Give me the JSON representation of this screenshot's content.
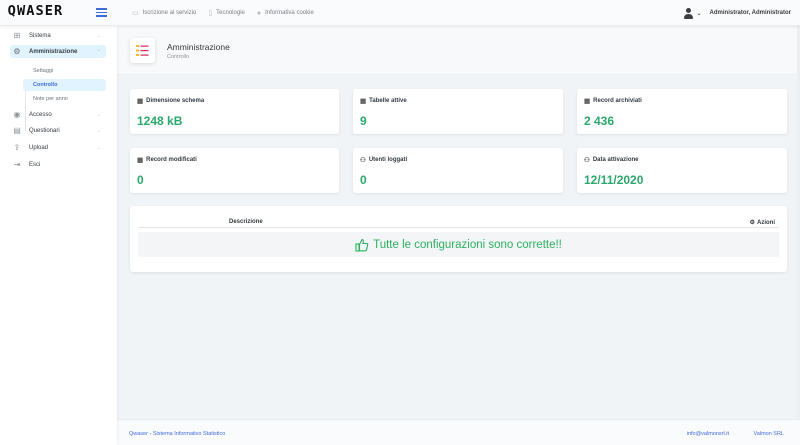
{
  "app": {
    "logo_text": "QWASER"
  },
  "topbar": {
    "nav": [
      {
        "label": "Iscrizione al servizio",
        "icon": "monitor-icon"
      },
      {
        "label": "Tecnologie",
        "icon": "document-icon"
      },
      {
        "label": "Informativa cookie",
        "icon": "cookie-icon"
      }
    ],
    "user_name": "Administrator, Administrator"
  },
  "sidebar": {
    "items": [
      {
        "label": "Sistema",
        "icon": "sitemap-icon"
      },
      {
        "label": "Amministrazione",
        "icon": "users-cog-icon"
      },
      {
        "label": "Accesso",
        "icon": "accessibility-icon"
      },
      {
        "label": "Questionari",
        "icon": "clipboard-icon"
      },
      {
        "label": "Upload",
        "icon": "upload-icon"
      },
      {
        "label": "Esci",
        "icon": "exit-icon"
      }
    ],
    "subitems": [
      {
        "label": "Settaggi"
      },
      {
        "label": "Controllo"
      },
      {
        "label": "Note per anno"
      }
    ]
  },
  "header": {
    "title": "Amministrazione",
    "subtitle": "Controllo"
  },
  "cards": [
    {
      "title": "Dimensione schema",
      "value": "1248 kB",
      "icon": "table-icon"
    },
    {
      "title": "Tabelle attive",
      "value": "9",
      "icon": "table-icon"
    },
    {
      "title": "Record archiviati",
      "value": "2 436",
      "icon": "table-icon"
    },
    {
      "title": "Record modificati",
      "value": "0",
      "icon": "table-icon"
    },
    {
      "title": "Utenti loggati",
      "value": "0",
      "icon": "users-icon"
    },
    {
      "title": "Data attivazione",
      "value": "12/11/2020",
      "icon": "users-icon"
    }
  ],
  "table": {
    "headers": {
      "descrizione": "Descrizione",
      "azioni": "Azioni"
    },
    "message": "Tutte le configurazioni sono corrette!!"
  },
  "footer": {
    "left": "Qwaser - Sistema Informativo Statistico",
    "email": "info@valmonsrl.it",
    "company": "Valmon SRL"
  },
  "colors": {
    "accent": "#3f6ad8",
    "value_green": "#2ba86b",
    "ok_green": "#2bb25f",
    "active_bg": "#e0f3ff"
  }
}
